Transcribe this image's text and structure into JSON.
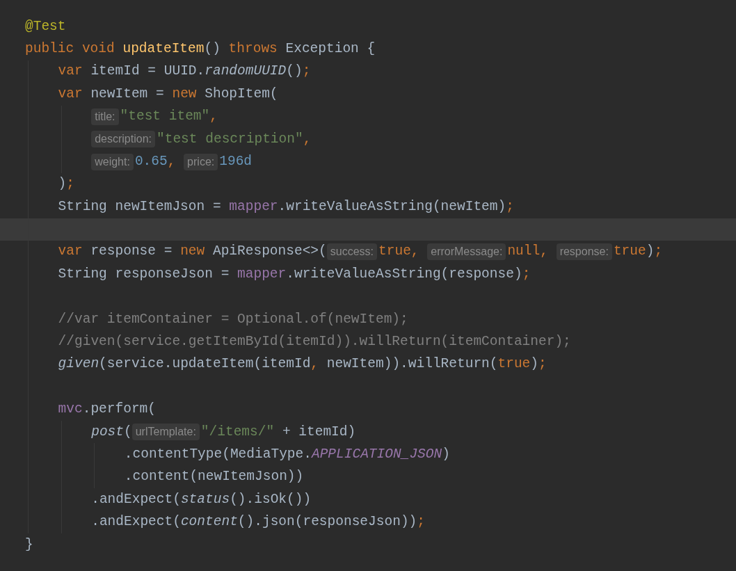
{
  "editor": {
    "lines": [
      {
        "current": false,
        "tokens": [
          {
            "kind": "annotation",
            "text": "@Test"
          }
        ]
      },
      {
        "current": false,
        "tokens": [
          {
            "kind": "keyword",
            "text": "public"
          },
          {
            "kind": "keyword",
            "text": " void"
          },
          {
            "kind": "method",
            "text": " updateItem"
          },
          {
            "kind": "plain",
            "text": "() "
          },
          {
            "kind": "keyword",
            "text": "throws"
          },
          {
            "kind": "plain",
            "text": " Exception {"
          }
        ],
        "children": [
          {
            "current": false,
            "tokens": [
              {
                "kind": "keyword",
                "text": "var"
              },
              {
                "kind": "plain",
                "text": " itemId = UUID."
              },
              {
                "kind": "static",
                "text": "randomUUID"
              },
              {
                "kind": "plain",
                "text": "()"
              },
              {
                "kind": "keyword",
                "text": ";"
              }
            ]
          },
          {
            "current": false,
            "tokens": [
              {
                "kind": "keyword",
                "text": "var"
              },
              {
                "kind": "plain",
                "text": " newItem = "
              },
              {
                "kind": "keyword",
                "text": "new"
              },
              {
                "kind": "plain",
                "text": " ShopItem("
              }
            ],
            "children": [
              {
                "current": false,
                "tokens": [
                  {
                    "kind": "hint",
                    "text": "title:"
                  },
                  {
                    "kind": "string",
                    "text": "\"test item\""
                  },
                  {
                    "kind": "keyword",
                    "text": ","
                  }
                ]
              },
              {
                "current": false,
                "tokens": [
                  {
                    "kind": "hint",
                    "text": "description:"
                  },
                  {
                    "kind": "string",
                    "text": "\"test description\""
                  },
                  {
                    "kind": "keyword",
                    "text": ","
                  }
                ]
              },
              {
                "current": false,
                "tokens": [
                  {
                    "kind": "hint",
                    "text": "weight:"
                  },
                  {
                    "kind": "number",
                    "text": "0.65"
                  },
                  {
                    "kind": "keyword",
                    "text": ", "
                  },
                  {
                    "kind": "hint",
                    "text": "price:"
                  },
                  {
                    "kind": "number",
                    "text": "196d"
                  }
                ]
              }
            ]
          },
          {
            "current": false,
            "tokens": [
              {
                "kind": "plain",
                "text": ")"
              },
              {
                "kind": "keyword",
                "text": ";"
              }
            ]
          },
          {
            "current": false,
            "tokens": [
              {
                "kind": "plain",
                "text": "String newItemJson = "
              },
              {
                "kind": "field",
                "text": "mapper"
              },
              {
                "kind": "plain",
                "text": ".writeValueAsString(newItem)"
              },
              {
                "kind": "keyword",
                "text": ";"
              }
            ]
          },
          {
            "current": true
          },
          {
            "current": false,
            "tokens": [
              {
                "kind": "keyword",
                "text": "var"
              },
              {
                "kind": "plain",
                "text": " response = "
              },
              {
                "kind": "keyword",
                "text": "new"
              },
              {
                "kind": "plain",
                "text": " ApiResponse<>("
              },
              {
                "kind": "hint",
                "text": "success:"
              },
              {
                "kind": "keyword",
                "text": "true"
              },
              {
                "kind": "keyword",
                "text": ", "
              },
              {
                "kind": "hint",
                "text": "errorMessage:"
              },
              {
                "kind": "keyword",
                "text": "null"
              },
              {
                "kind": "keyword",
                "text": ", "
              },
              {
                "kind": "hint",
                "text": "response:"
              },
              {
                "kind": "keyword",
                "text": "true"
              },
              {
                "kind": "plain",
                "text": ")"
              },
              {
                "kind": "keyword",
                "text": ";"
              }
            ]
          },
          {
            "current": false,
            "tokens": [
              {
                "kind": "plain",
                "text": "String responseJson = "
              },
              {
                "kind": "field",
                "text": "mapper"
              },
              {
                "kind": "plain",
                "text": ".writeValueAsString(response)"
              },
              {
                "kind": "keyword",
                "text": ";"
              }
            ]
          },
          {
            "current": false,
            "blank_line_before": true,
            "tokens": [
              {
                "kind": "comment",
                "text": "//var itemContainer = Optional.of(newItem);"
              }
            ]
          },
          {
            "current": false,
            "tokens": [
              {
                "kind": "comment",
                "text": "//given(service.getItemById(itemId)).willReturn(itemContainer);"
              }
            ]
          },
          {
            "current": false,
            "tokens": [
              {
                "kind": "static",
                "text": "given"
              },
              {
                "kind": "plain",
                "text": "(service.updateItem(itemId"
              },
              {
                "kind": "keyword",
                "text": ","
              },
              {
                "kind": "plain",
                "text": " newItem)).willReturn("
              },
              {
                "kind": "keyword",
                "text": "true"
              },
              {
                "kind": "plain",
                "text": ")"
              },
              {
                "kind": "keyword",
                "text": ";"
              }
            ]
          },
          {
            "current": false,
            "blank_line_before": true,
            "tokens": [
              {
                "kind": "field",
                "text": "mvc"
              },
              {
                "kind": "plain",
                "text": ".perform("
              }
            ],
            "children": [
              {
                "current": false,
                "tokens": [
                  {
                    "kind": "static",
                    "text": "post"
                  },
                  {
                    "kind": "plain",
                    "text": "("
                  },
                  {
                    "kind": "hint",
                    "text": "urlTemplate:"
                  },
                  {
                    "kind": "string",
                    "text": "\"/items/\""
                  },
                  {
                    "kind": "plain",
                    "text": " + itemId)"
                  }
                ],
                "children": [
                  {
                    "current": false,
                    "tokens": [
                      {
                        "kind": "plain",
                        "text": ".contentType(MediaType."
                      },
                      {
                        "kind": "constant",
                        "text": "APPLICATION_JSON"
                      },
                      {
                        "kind": "plain",
                        "text": ")"
                      }
                    ]
                  },
                  {
                    "current": false,
                    "tokens": [
                      {
                        "kind": "plain",
                        "text": ".content(newItemJson))"
                      }
                    ]
                  }
                ]
              },
              {
                "current": false,
                "tokens": [
                  {
                    "kind": "plain",
                    "text": ".andExpect("
                  },
                  {
                    "kind": "static",
                    "text": "status"
                  },
                  {
                    "kind": "plain",
                    "text": "().isOk())"
                  }
                ]
              },
              {
                "current": false,
                "tokens": [
                  {
                    "kind": "plain",
                    "text": ".andExpect("
                  },
                  {
                    "kind": "static",
                    "text": "content"
                  },
                  {
                    "kind": "plain",
                    "text": "().json(responseJson))"
                  },
                  {
                    "kind": "keyword",
                    "text": ";"
                  }
                ]
              }
            ]
          }
        ]
      },
      {
        "current": false,
        "tokens": [
          {
            "kind": "plain",
            "text": "}"
          }
        ]
      }
    ]
  }
}
